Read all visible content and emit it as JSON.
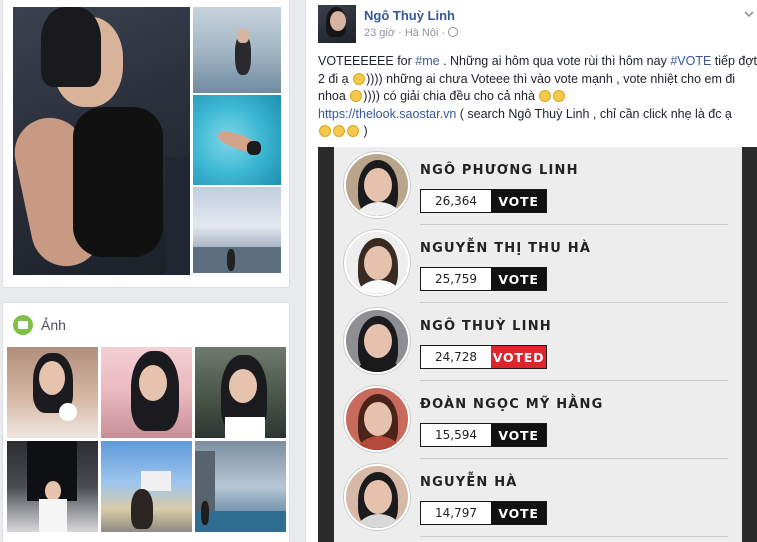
{
  "left_photos": {
    "main_alt": "profile-feature-photo",
    "thumbs": [
      "beach-photo",
      "pool-photo",
      "coast-photo"
    ]
  },
  "photos_section": {
    "title": "Ảnh",
    "tiles": [
      "portrait-1",
      "portrait-2",
      "portrait-3",
      "portrait-4",
      "portrait-5",
      "portrait-6"
    ]
  },
  "post": {
    "author": "Ngô Thuỳ Linh",
    "meta": "23 giờ · Hà Nội ·",
    "text": {
      "p1": "VOTEEEEEE for ",
      "tag1": "#me",
      "p2": " . Những ai hôm qua vote rùi thì hôm nay ",
      "tag2": "#VOTE",
      "p3": " tiếp đợt 2 đi ạ ",
      "p4": ")))) những ai chưa Voteee thì vào vote mạnh , vote nhiệt cho em đi nhoa ",
      "p5": ")))) có giải chia đều cho cả nhà ",
      "link": "https://thelook.saostar.vn",
      "p6": " ( search Ngô Thuỳ Linh , chỉ cần click nhẹ là đc ạ ",
      "p7": " )"
    }
  },
  "contestants": [
    {
      "name": "NGÔ PHƯƠNG LINH",
      "count": "26,364",
      "button": "VOTE",
      "voted": false,
      "bg": "#b9a58c"
    },
    {
      "name": "NGUYỄN THỊ THU HÀ",
      "count": "25,759",
      "button": "VOTE",
      "voted": false,
      "bg": "#eeeeee"
    },
    {
      "name": "NGÔ THUỲ LINH",
      "count": "24,728",
      "button": "VOTED",
      "voted": true,
      "bg": "#8e8f92"
    },
    {
      "name": "ĐOÀN NGỌC MỸ HẰNG",
      "count": "15,594",
      "button": "VOTE",
      "voted": false,
      "bg": "#c96b5c"
    },
    {
      "name": "NGUYỄN HÀ",
      "count": "14,797",
      "button": "VOTE",
      "voted": false,
      "bg": "#d7b9a8"
    }
  ],
  "colors": {
    "link": "#365899",
    "voted": "#e0242b",
    "vote": "#111111"
  }
}
